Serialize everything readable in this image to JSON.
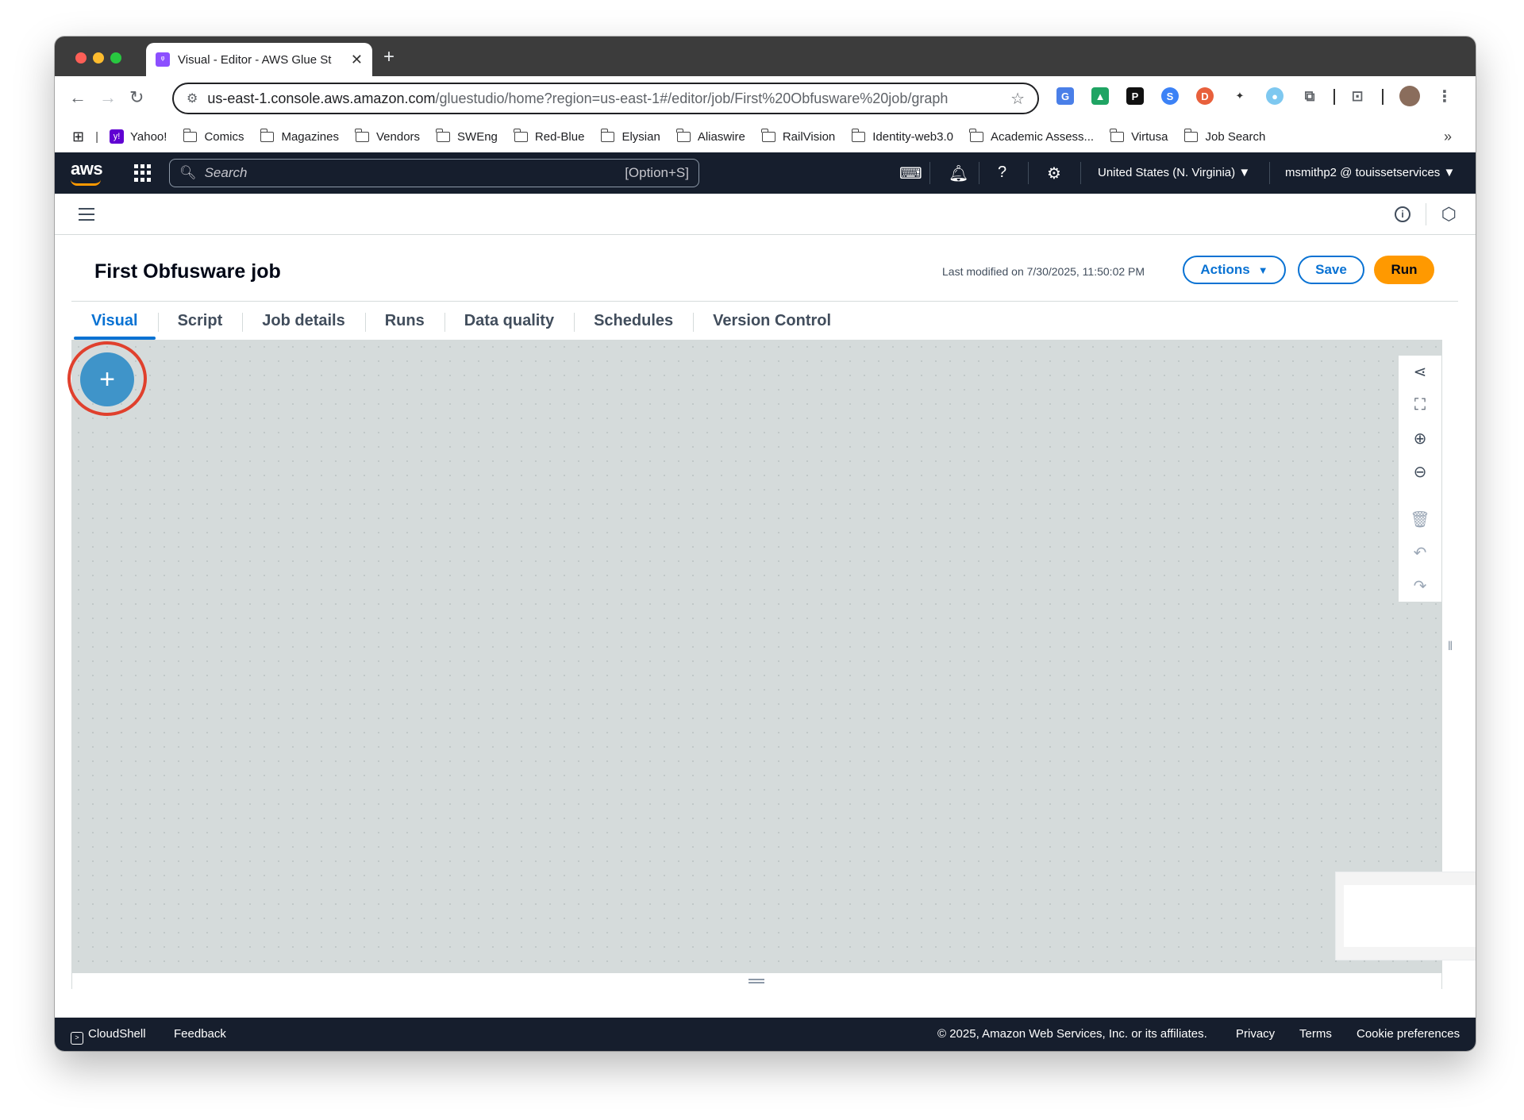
{
  "browser": {
    "tab_title": "Visual - Editor - AWS Glue St",
    "url_host": "us-east-1.console.aws.amazon.com",
    "url_path": "/gluestudio/home?region=us-east-1#/editor/job/First%20Obfusware%20job/graph",
    "bookmarks": [
      "Yahoo!",
      "Comics",
      "Magazines",
      "Vendors",
      "SWEng",
      "Red-Blue",
      "Elysian",
      "Aliaswire",
      "RailVision",
      "Identity-web3.0",
      "Academic Assess...",
      "Virtusa",
      "Job Search"
    ]
  },
  "aws_header": {
    "logo": "aws",
    "search_placeholder": "Search",
    "search_shortcut": "[Option+S]",
    "region": "United States (N. Virginia)",
    "account": "msmithp2 @ touissetservices"
  },
  "job": {
    "title": "First Obfusware job",
    "last_modified": "Last modified on 7/30/2025, 11:50:02 PM",
    "actions_label": "Actions",
    "save_label": "Save",
    "run_label": "Run"
  },
  "tabs": [
    {
      "label": "Visual",
      "active": true
    },
    {
      "label": "Script"
    },
    {
      "label": "Job details"
    },
    {
      "label": "Runs"
    },
    {
      "label": "Data quality"
    },
    {
      "label": "Schedules"
    },
    {
      "label": "Version Control"
    }
  ],
  "canvas": {
    "add_symbol": "+",
    "tools": [
      "share-layout-icon",
      "fit-screen-icon",
      "zoom-in-icon",
      "zoom-out-icon",
      "delete-icon",
      "undo-icon",
      "redo-icon"
    ]
  },
  "footer": {
    "cloudshell": "CloudShell",
    "feedback": "Feedback",
    "copyright": "© 2025, Amazon Web Services, Inc. or its affiliates.",
    "privacy": "Privacy",
    "terms": "Terms",
    "cookies": "Cookie preferences"
  },
  "colors": {
    "aws_nav": "#161e2d",
    "accent_blue": "#0972d3",
    "run_orange": "#ff9900",
    "add_node_blue": "#3f94c9",
    "highlight_red": "#e0402d"
  }
}
